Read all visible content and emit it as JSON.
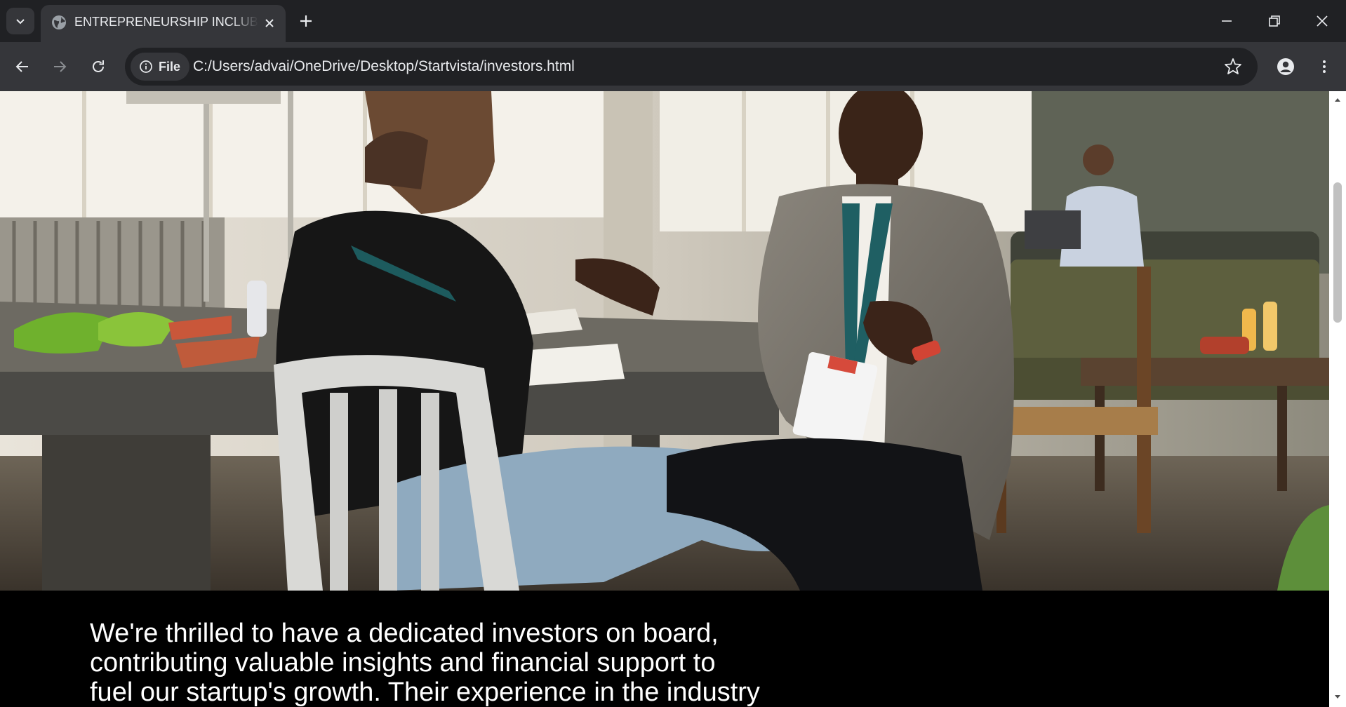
{
  "browser": {
    "tab_title": "ENTREPRENEURSHIP INCLUBLAB",
    "site_chip_label": "File",
    "url": "C:/Users/advai/OneDrive/Desktop/Startvista/investors.html",
    "icons": {
      "tab_search": "chevron-down-icon",
      "favicon": "globe-icon",
      "tab_close": "close-icon",
      "new_tab": "plus-icon",
      "minimize": "minimize-icon",
      "restore": "restore-icon",
      "close_window": "close-icon",
      "back": "arrow-left-icon",
      "forward": "arrow-right-icon",
      "reload": "reload-icon",
      "site_info": "info-icon",
      "bookmark": "star-icon",
      "profile": "profile-icon",
      "menu": "kebab-menu-icon"
    },
    "colors": {
      "tabstrip": "#202124",
      "toolbar": "#35363a",
      "text": "#e8eaed"
    }
  },
  "page": {
    "hero_image": "photo of two men talking at a table in a coworking cafe",
    "intro_text": "We're thrilled to have a dedicated investors on board, contributing valuable insights and financial support to fuel our startup's growth. Their experience in the industry brings"
  }
}
